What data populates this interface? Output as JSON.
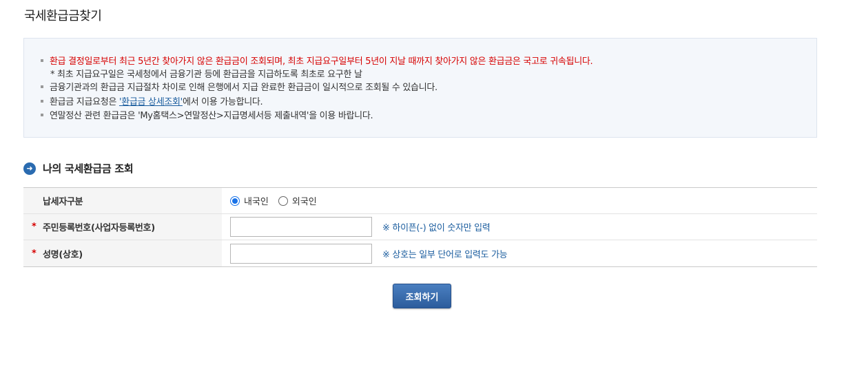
{
  "page": {
    "title": "국세환급금찾기"
  },
  "notice": {
    "line1": "환급 결정일로부터 최근 5년간 찾아가지 않은 환급금이 조회되며, 최초 지급요구일부터 5년이 지날 때까지 찾아가지 않은 환급금은 국고로 귀속됩니다.",
    "line1_sub": "* 최초 지급요구일은 국세청에서 금융기관 등에 환급금을 지급하도록 최초로 요구한 날",
    "line2": "금융기관과의 환급금 지급절차 차이로 인해 은행에서 지급 완료한 환급금이 일시적으로 조회될 수 있습니다.",
    "line3_prefix": "환급금 지급요청은 ",
    "line3_link": "'환급금 상세조회'",
    "line3_suffix": "에서 이용 가능합니다.",
    "line4": "연말정산 관련 환급금은 'My홈택스>연말정산>지급명세서등 제출내역'을 이용 바랍니다.",
    "warning_color": "#d60000"
  },
  "section": {
    "icon": "arrow-right-circle-icon",
    "title": "나의 국세환급금 조회"
  },
  "form": {
    "taxpayer_type": {
      "label": "납세자구분",
      "options": [
        {
          "label": "내국인",
          "checked": true
        },
        {
          "label": "외국인",
          "checked": false
        }
      ]
    },
    "id_number": {
      "required_mark": "*",
      "label": "주민등록번호(사업자등록번호)",
      "value": "",
      "hint": "※ 하이픈(-) 없이 숫자만 입력"
    },
    "name": {
      "required_mark": "*",
      "label": "성명(상호)",
      "value": "",
      "hint": "※ 상호는 일부 단어로 입력도 가능"
    }
  },
  "actions": {
    "search_label": "조회하기"
  },
  "colors": {
    "accent": "#2c5c9c",
    "hint": "#1a5c9e"
  }
}
